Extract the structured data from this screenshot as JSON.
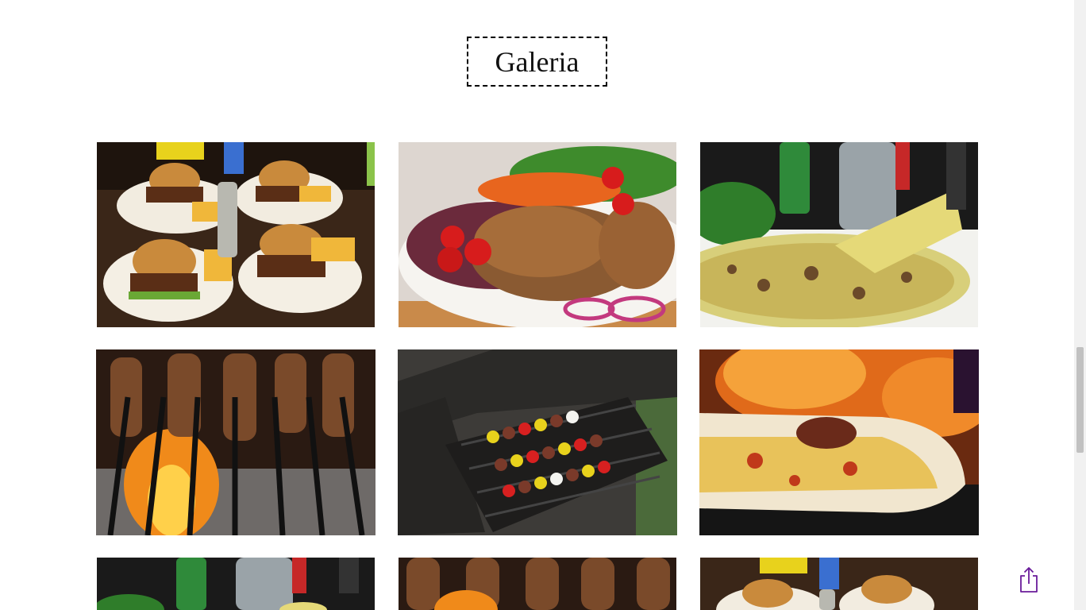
{
  "gallery": {
    "title": "Galeria",
    "images": [
      {
        "subject": "burgers-and-fries"
      },
      {
        "subject": "grilled-meat-platter"
      },
      {
        "subject": "pizza-slice-server"
      },
      {
        "subject": "skewers-over-fire"
      },
      {
        "subject": "kebabs-on-grill"
      },
      {
        "subject": "pizza-with-flames"
      },
      {
        "subject": "pizza-slice-server"
      },
      {
        "subject": "skewers-over-fire"
      },
      {
        "subject": "burgers-and-fries"
      }
    ]
  },
  "share": {
    "icon": "share-icon",
    "color": "#6a1b9a"
  }
}
